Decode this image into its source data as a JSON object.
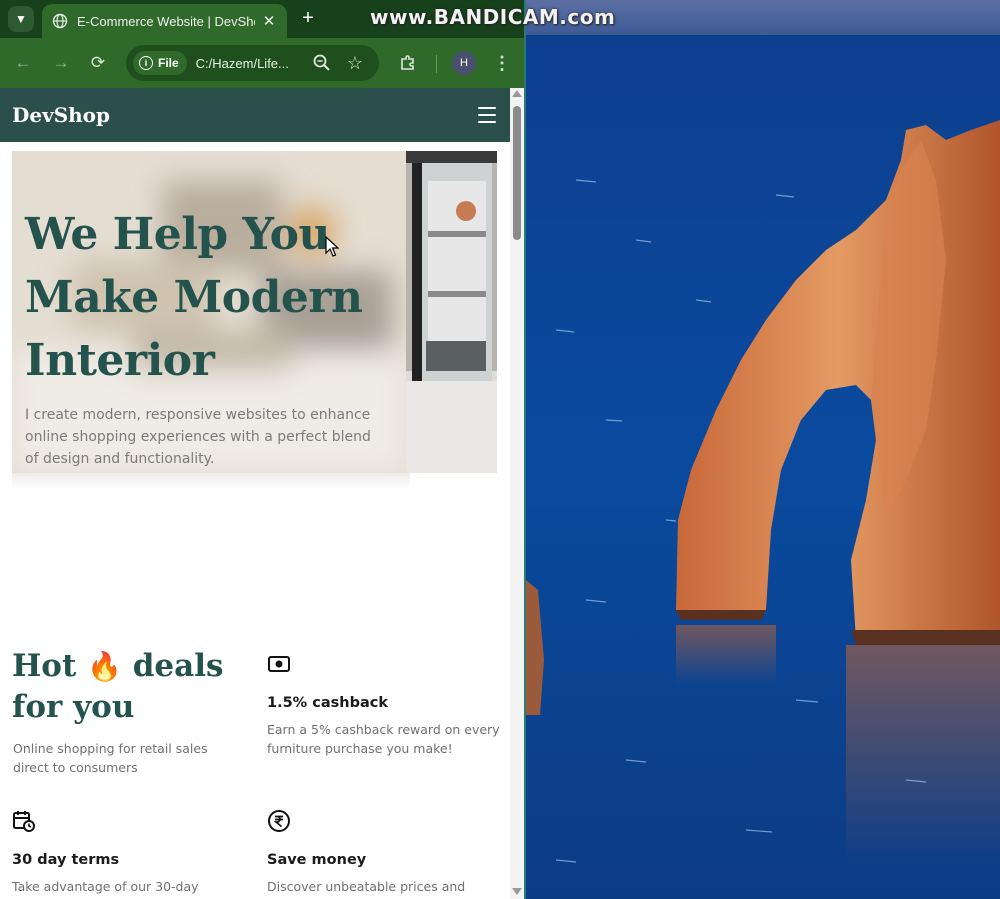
{
  "watermark": "www.BANDICAM.com",
  "browser": {
    "tab_title": "E-Commerce Website | DevShop",
    "tab_close": "✕",
    "new_tab": "+",
    "file_chip": "File",
    "url": "C:/Hazem/Life...",
    "profile_initial": "H"
  },
  "site": {
    "logo": "DevShop",
    "hero": {
      "title_lines": [
        "We Help You",
        "Make Modern",
        "Interior"
      ],
      "text": "I create modern, responsive websites to enhance online shopping experiences with a perfect blend of design and functionality."
    },
    "deals": {
      "title_part1": "Hot ",
      "title_emoji": "🔥",
      "title_part2": " deals",
      "title_line2": "for you",
      "subtitle": "Online shopping for retail sales direct to consumers"
    },
    "features": [
      {
        "icon": "cash-icon",
        "title": "1.5% cashback",
        "text": "Earn a 5% cashback reward on every furniture purchase you make!"
      },
      {
        "icon": "calendar-clock-icon",
        "title": "30 day terms",
        "text": "Take advantage of our 30-day"
      },
      {
        "icon": "rupee-icon",
        "title": "Save money",
        "text": "Discover unbeatable prices and"
      }
    ]
  },
  "colors": {
    "tabbar": "#16411a",
    "toolbar": "#2f6a2a",
    "site_header": "#2b4f4b",
    "heading": "#24524c"
  }
}
